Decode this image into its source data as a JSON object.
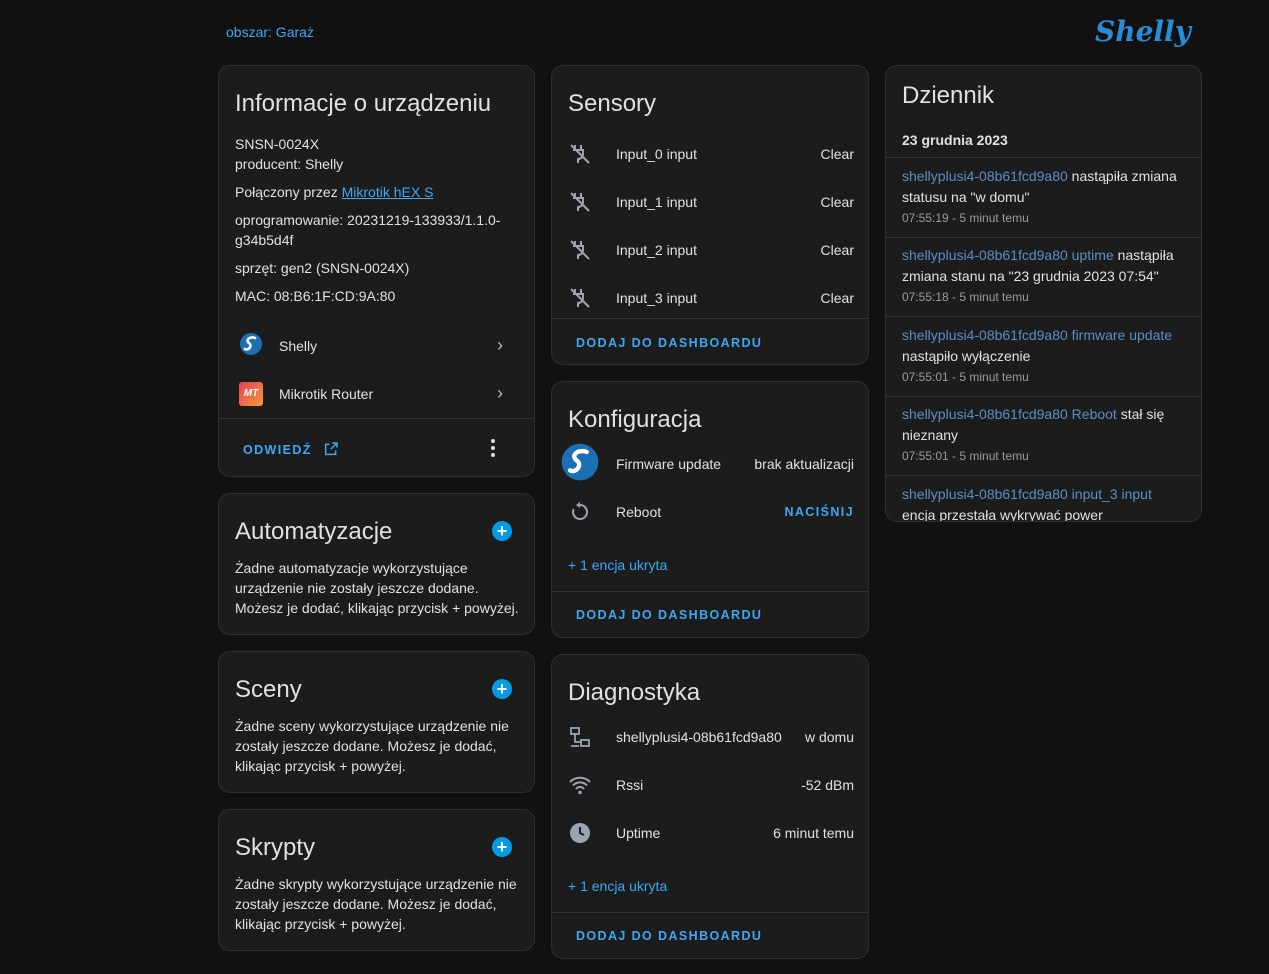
{
  "header": {
    "area_link": "obszar: Garaż",
    "logo_text": "Shelly"
  },
  "device_info": {
    "title": "Informacje o urządzeniu",
    "model": "SNSN-0024X",
    "manufacturer": "producent: Shelly",
    "connected_prefix": "Połączony przez ",
    "connected_link": "Mikrotik hEX S",
    "firmware_line1": "oprogramowanie: 20231219-133933/1.1.0-",
    "firmware_line2": "g34b5d4f",
    "hardware": "sprzęt: gen2 (SNSN-0024X)",
    "mac": "MAC: 08:B6:1F:CD:9A:80",
    "integrations": [
      {
        "label": "Shelly",
        "icon": "shelly-logo-icon"
      },
      {
        "label": "Mikrotik Router",
        "icon": "mikrotik-logo-icon"
      }
    ],
    "visit_label": "ODWIEDŹ"
  },
  "automations": {
    "title": "Automatyzacje",
    "text": "Żadne automatyzacje wykorzystujące urządzenie nie zostały jeszcze dodane. Możesz je dodać, klikając przycisk + powyżej."
  },
  "scenes": {
    "title": "Sceny",
    "text": "Żadne sceny wykorzystujące urządzenie nie zostały jeszcze dodane. Możesz je dodać, klikając przycisk + powyżej."
  },
  "scripts": {
    "title": "Skrypty",
    "text": "Żadne skrypty wykorzystujące urządzenie nie zostały jeszcze dodane. Możesz je dodać, klikając przycisk + powyżej."
  },
  "sensors": {
    "title": "Sensory",
    "items": [
      {
        "name": "Input_0 input",
        "state": "Clear",
        "icon": "power-plug-off-icon"
      },
      {
        "name": "Input_1 input",
        "state": "Clear",
        "icon": "power-plug-off-icon"
      },
      {
        "name": "Input_2 input",
        "state": "Clear",
        "icon": "power-plug-off-icon"
      },
      {
        "name": "Input_3 input",
        "state": "Clear",
        "icon": "power-plug-off-icon"
      }
    ],
    "add_label": "DODAJ DO DASHBOARDU"
  },
  "config": {
    "title": "Konfiguracja",
    "items": [
      {
        "name": "Firmware update",
        "state": "brak aktualizacji",
        "icon": "shelly-logo-icon"
      },
      {
        "name": "Reboot",
        "state": "NACIŚNIJ",
        "icon": "restart-icon"
      }
    ],
    "hidden": "+ 1 encja ukryta",
    "add_label": "DODAJ DO DASHBOARDU"
  },
  "diagnostics": {
    "title": "Diagnostyka",
    "items": [
      {
        "name": "shellyplusi4-08b61fcd9a80",
        "state": "w domu",
        "icon": "lan-icon"
      },
      {
        "name": "Rssi",
        "state": "-52 dBm",
        "icon": "wifi-icon"
      },
      {
        "name": "Uptime",
        "state": "6 minut temu",
        "icon": "clock-icon"
      }
    ],
    "hidden": "+ 1 encja ukryta",
    "add_label": "DODAJ DO DASHBOARDU"
  },
  "logbook": {
    "title": "Dziennik",
    "date": "23 grudnia 2023",
    "entries": [
      {
        "entity": "shellyplusi4-08b61fcd9a80",
        "msg": " nastąpiła zmiana statusu na \"w domu\"",
        "time": "07:55:19 - 5 minut temu"
      },
      {
        "entity": "shellyplusi4-08b61fcd9a80 uptime",
        "msg": " nastąpiła zmiana stanu na \"23 grudnia 2023 07:54\"",
        "time": "07:55:18 - 5 minut temu"
      },
      {
        "entity": "shellyplusi4-08b61fcd9a80 firmware update",
        "msg": " nastąpiło wyłączenie",
        "time": "07:55:01 - 5 minut temu"
      },
      {
        "entity": "shellyplusi4-08b61fcd9a80 Reboot",
        "msg": " stał się nieznany",
        "time": "07:55:01 - 5 minut temu"
      },
      {
        "entity": "shellyplusi4-08b61fcd9a80 input_3 input",
        "msg": " encja przestała wykrywać power",
        "time": ""
      }
    ]
  },
  "colors": {
    "accent": "#3da8f5",
    "background": "#111111",
    "card": "#1c1c1c",
    "plus_button": "#039be5"
  }
}
